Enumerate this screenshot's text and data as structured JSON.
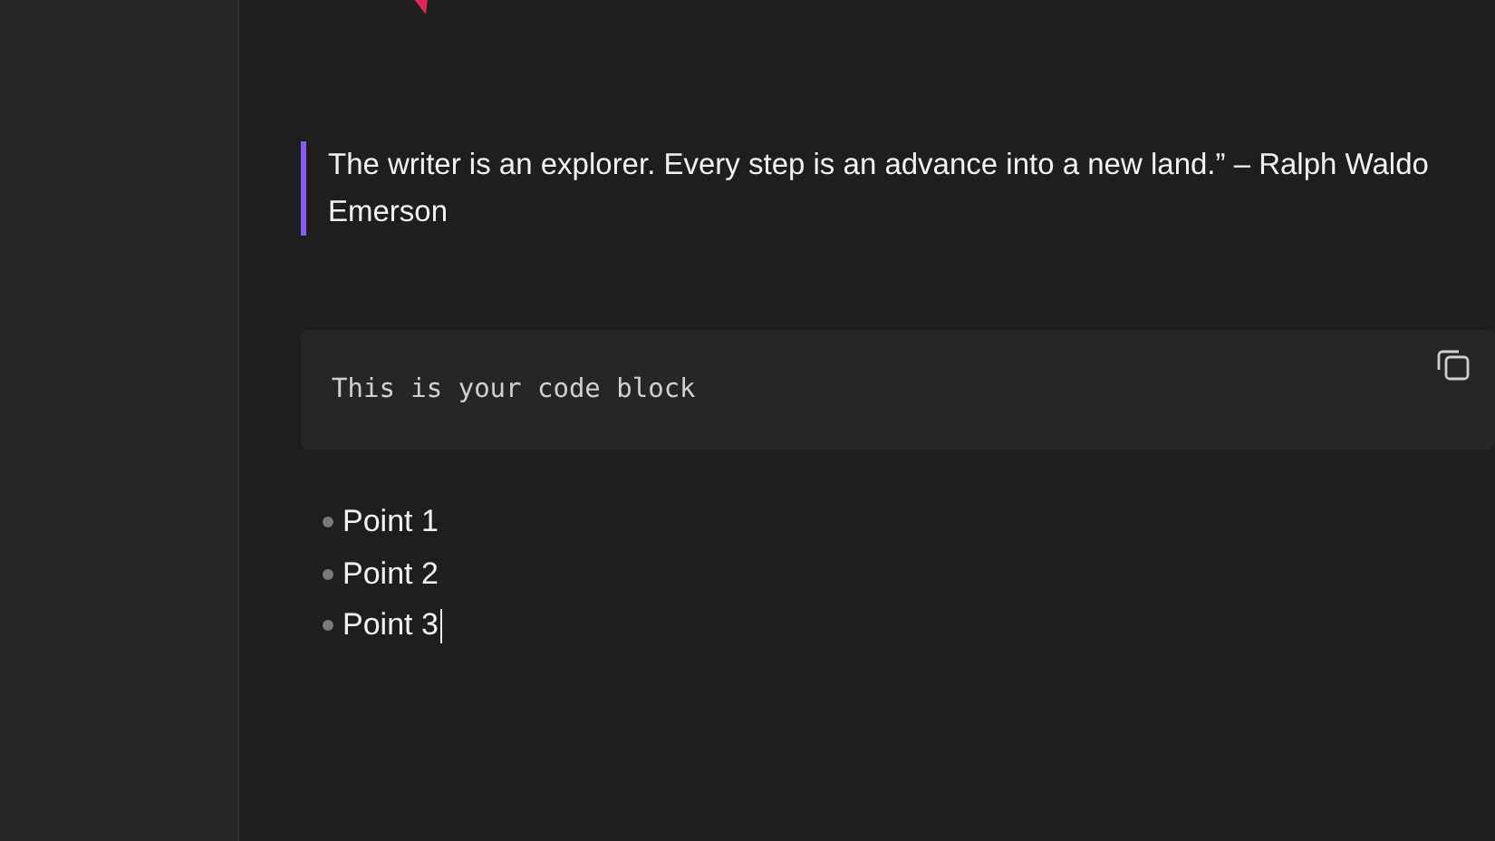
{
  "quote": {
    "text": "The writer is an explorer. Every step is an advance into a new land.” – Ralph Waldo Emerson"
  },
  "code_block": {
    "text": "This is your code block"
  },
  "bullet_list": [
    {
      "text": "Point 1"
    },
    {
      "text": "Point 2"
    },
    {
      "text": "Point 3"
    }
  ]
}
